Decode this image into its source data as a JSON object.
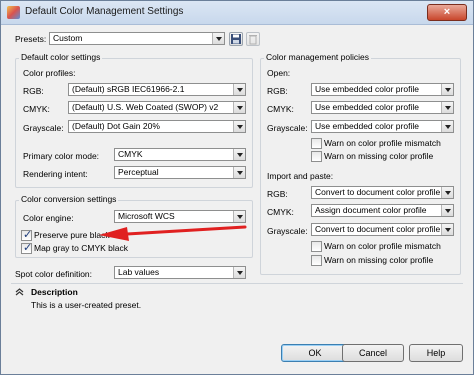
{
  "window": {
    "title": "Default Color Management Settings",
    "close_glyph": "×"
  },
  "presets": {
    "label": "Presets:",
    "value": "Custom"
  },
  "default_color": {
    "title": "Default color settings",
    "profiles_label": "Color profiles:",
    "rgb_label": "RGB:",
    "rgb_value": "(Default) sRGB IEC61966-2.1",
    "cmyk_label": "CMYK:",
    "cmyk_value": "(Default) U.S. Web Coated (SWOP) v2",
    "gray_label": "Grayscale:",
    "gray_value": "(Default) Dot Gain 20%",
    "primary_label": "Primary color mode:",
    "primary_value": "CMYK",
    "intent_label": "Rendering intent:",
    "intent_value": "Perceptual"
  },
  "conversion": {
    "title": "Color conversion settings",
    "engine_label": "Color engine:",
    "engine_value": "Microsoft WCS",
    "preserve_black": "Preserve pure black",
    "preserve_black_checked": true,
    "map_gray": "Map gray to CMYK black",
    "map_gray_checked": true
  },
  "spot": {
    "label": "Spot color definition:",
    "value": "Lab values"
  },
  "policies": {
    "title": "Color management policies",
    "open_label": "Open:",
    "rgb_label": "RGB:",
    "rgb_value": "Use embedded color profile",
    "cmyk_label": "CMYK:",
    "cmyk_value": "Use embedded color profile",
    "gray_label": "Grayscale:",
    "gray_value": "Use embedded color profile",
    "warn_mismatch": "Warn on color profile mismatch",
    "warn_missing": "Warn on missing color profile",
    "import_label": "Import and paste:",
    "imp_rgb_label": "RGB:",
    "imp_rgb_value": "Convert to document color profile",
    "imp_cmyk_label": "CMYK:",
    "imp_cmyk_value": "Assign document color profile",
    "imp_gray_label": "Grayscale:",
    "imp_gray_value": "Convert to document color profile",
    "imp_warn_mismatch": "Warn on color profile mismatch",
    "imp_warn_missing": "Warn on missing color profile"
  },
  "description": {
    "title": "Description",
    "text": "This is a user-created preset."
  },
  "buttons": {
    "ok": "OK",
    "cancel": "Cancel",
    "help": "Help"
  },
  "colors": {
    "annotation_arrow": "#e02020"
  }
}
